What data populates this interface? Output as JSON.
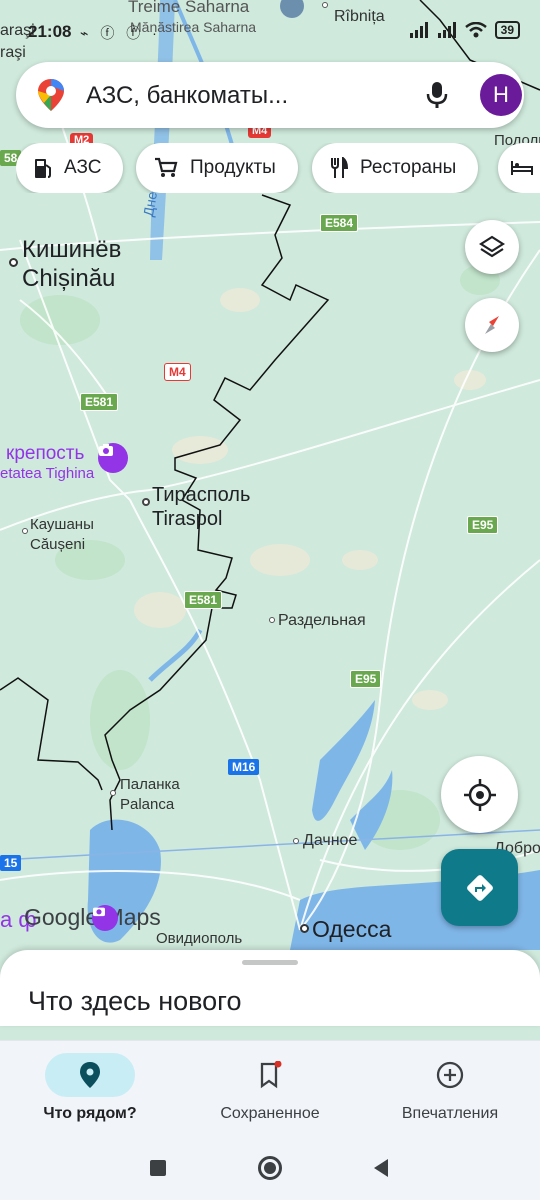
{
  "status_bar": {
    "time": "21:08",
    "battery": "39",
    "app_icons": "⌁ ⓕ ⓕ ·"
  },
  "search": {
    "placeholder_text": "АЗС, банкоматы...",
    "avatar_letter": "Н"
  },
  "chips": [
    {
      "label": "АЗС",
      "icon": "gas-station-icon"
    },
    {
      "label": "Продукты",
      "icon": "shopping-cart-icon"
    },
    {
      "label": "Рестораны",
      "icon": "restaurant-icon"
    },
    {
      "label": "",
      "icon": "hotel-bed-icon"
    }
  ],
  "map": {
    "labels": {
      "treime": "Treime Saharna",
      "manastirea": "Mănăstirea Saharna",
      "ribnita": "Rîbnița",
      "arasi": "araşi",
      "rasi": "raşi",
      "podolsk": "Подольс",
      "kishinev": "Кишинёв",
      "chisinau": "Chișinău",
      "dnestr": "Днестр",
      "krepost": "крепость",
      "cetatea": "etatea Tighina",
      "tiraspol_ru": "Тирасполь",
      "tiraspol_ro": "Tiraspol",
      "kaushany": "Каушаны",
      "causeni": "Căușeni",
      "razdelnaya": "Раздельная",
      "palanka": "Паланка",
      "palanca": "Palanca",
      "dachnoe": "Дачное",
      "dobro": "Добро",
      "odessa": "Одесса",
      "ovidiopol": "Овидиополь",
      "watermark_prefix": "а ф",
      "watermark": "Google Maps"
    },
    "shields": {
      "m2": "M2",
      "m4": "M4",
      "n58": "58",
      "e584": "E584",
      "m4b": "M4",
      "e581a": "E581",
      "e95a": "E95",
      "e581b": "E581",
      "e95b": "E95",
      "m16": "M16",
      "n15": "15"
    }
  },
  "bottom_sheet": {
    "title": "Что здесь нового"
  },
  "bottom_nav": [
    {
      "label": "Что рядом?",
      "icon": "location-pin-icon",
      "active": true
    },
    {
      "label": "Сохраненное",
      "icon": "bookmark-icon",
      "active": false
    },
    {
      "label": "Впечатления",
      "icon": "add-circle-icon",
      "active": false
    }
  ],
  "colors": {
    "map_background": "#cfe9dc",
    "road_yellow_shield": "#6aa84f",
    "road_blue_shield": "#1a73e8",
    "directions_button": "#0e7a8a",
    "avatar": "#6a1b9a",
    "poi_purple": "#9334e6",
    "nav_active_pill": "#c9edf4"
  }
}
